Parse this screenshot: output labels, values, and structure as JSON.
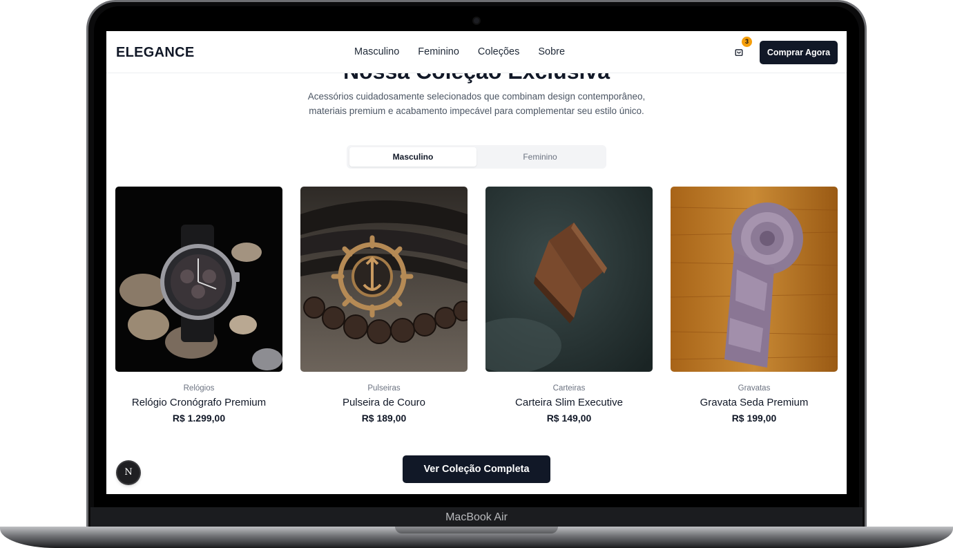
{
  "device": {
    "label": "MacBook Air"
  },
  "header": {
    "logo": "ELEGANCE",
    "nav": [
      "Masculino",
      "Feminino",
      "Coleções",
      "Sobre"
    ],
    "cart_count": "3",
    "cta_label": "Comprar Agora"
  },
  "hero": {
    "title": "Nossa Coleção Exclusiva",
    "subtitle_line1": "Acessórios cuidadosamente selecionados que combinam design contemporâneo,",
    "subtitle_line2": "materiais premium e acabamento impecável para complementar seu estilo único."
  },
  "tabs": {
    "active": "Masculino",
    "inactive": "Feminino"
  },
  "products": [
    {
      "category": "Relógios",
      "name": "Relógio Cronógrafo Premium",
      "price": "R$ 1.299,00",
      "image": "chronograph-watch"
    },
    {
      "category": "Pulseiras",
      "name": "Pulseira de Couro",
      "price": "R$ 189,00",
      "image": "leather-bracelet"
    },
    {
      "category": "Carteiras",
      "name": "Carteira Slim Executive",
      "price": "R$ 149,00",
      "image": "leather-wallet"
    },
    {
      "category": "Gravatas",
      "name": "Gravata Seda Premium",
      "price": "R$ 199,00",
      "image": "silk-tie"
    }
  ],
  "view_all_label": "Ver Coleção Completa",
  "dev_badge": "N",
  "colors": {
    "primary": "#111827",
    "badge": "#f59e0b"
  }
}
